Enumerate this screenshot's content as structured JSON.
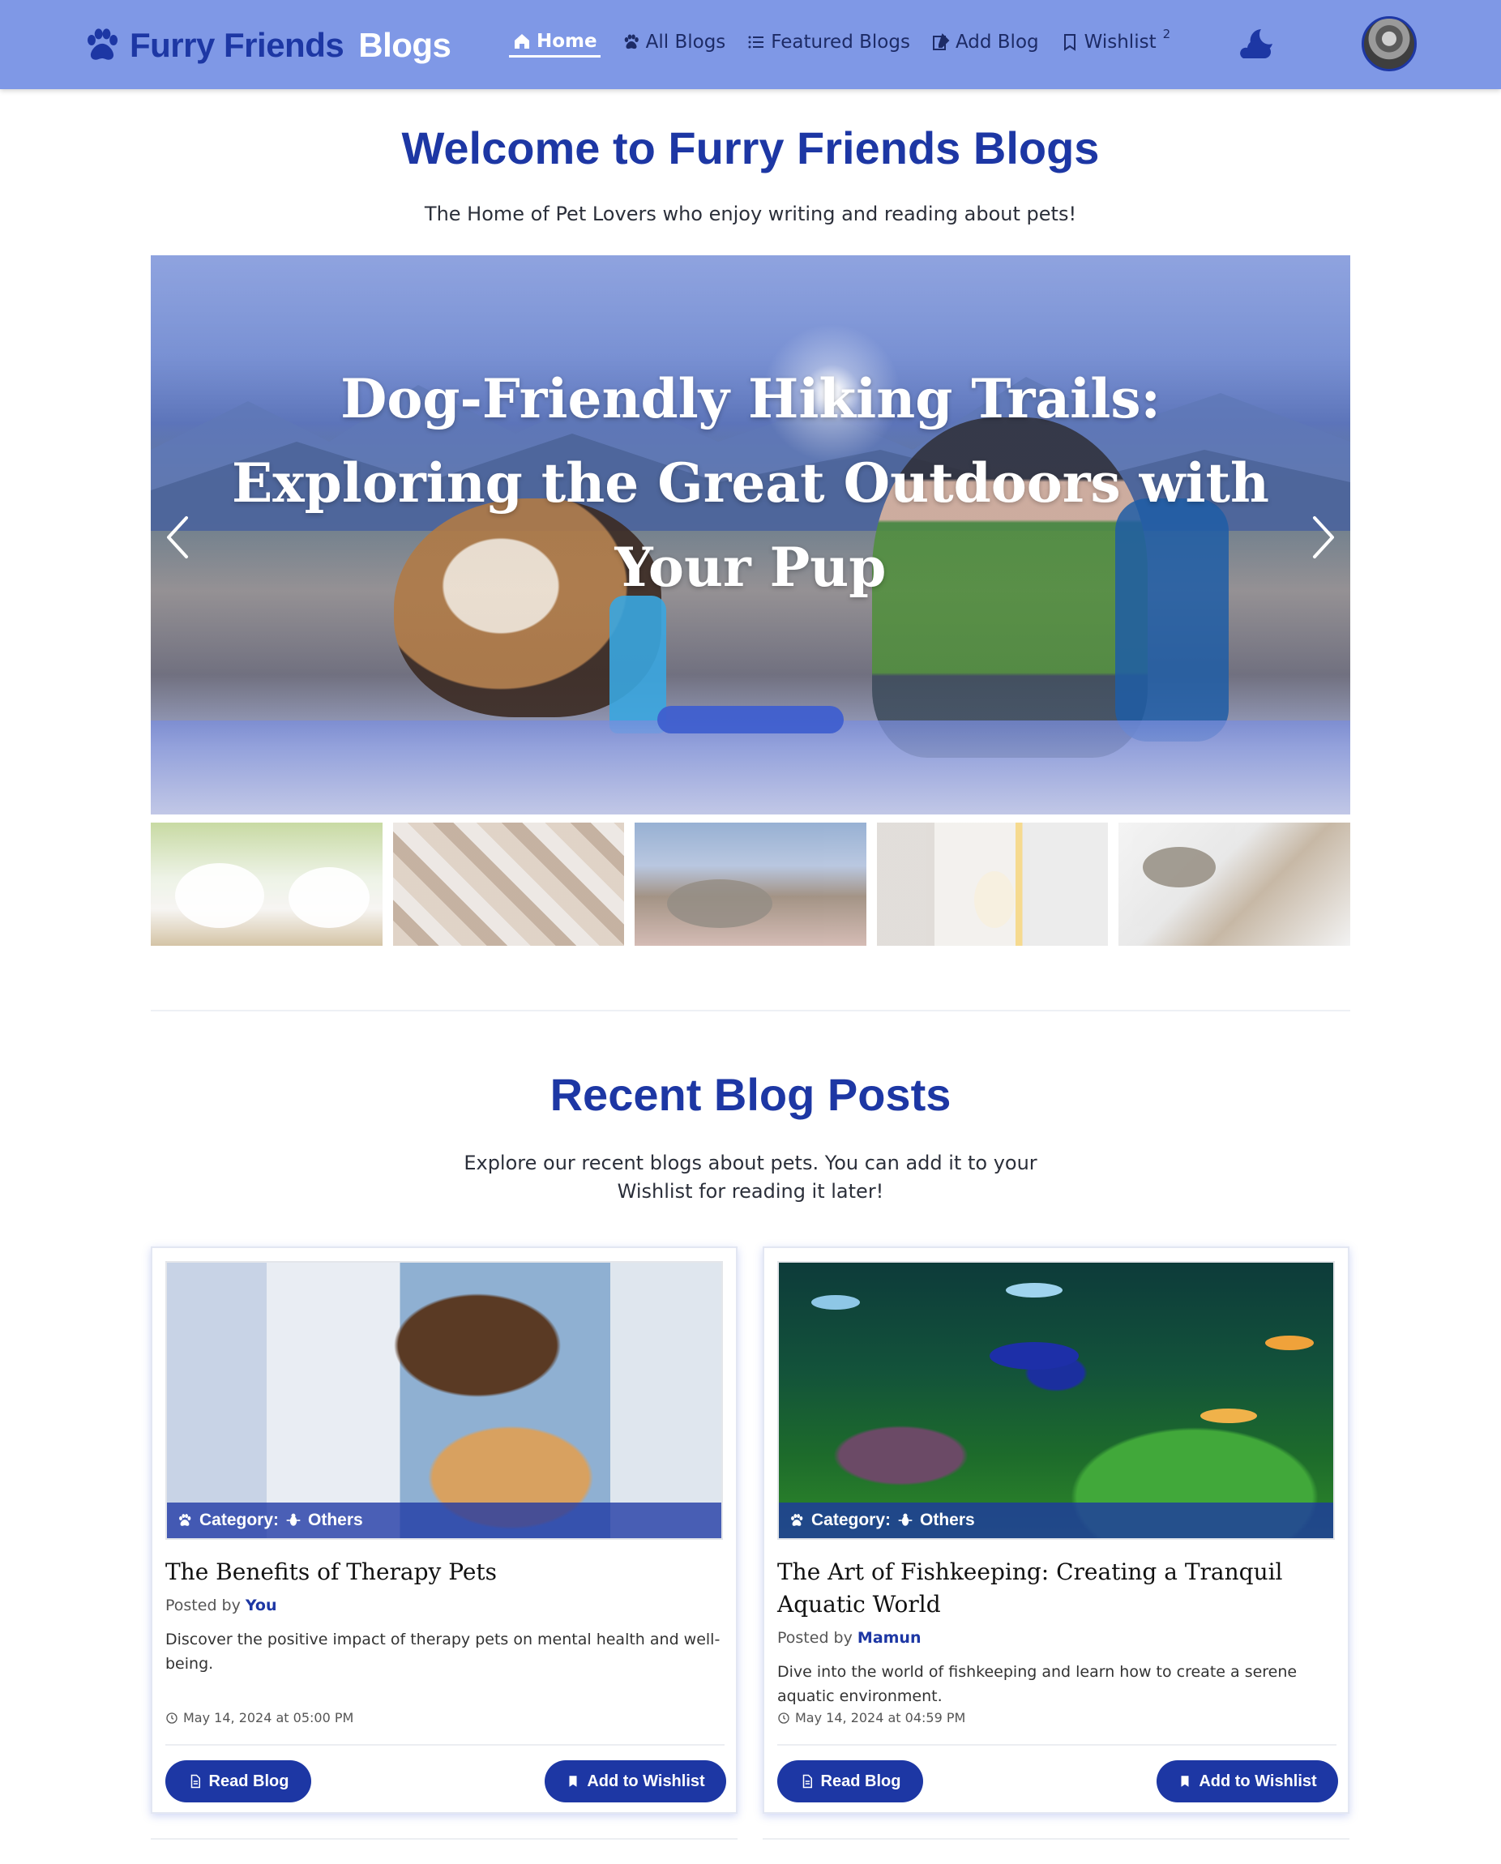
{
  "navbar": {
    "brand_part1": "Furry Friends",
    "brand_part2": "Blogs",
    "brand_icon": "paw-icon",
    "links": [
      {
        "label": "Home",
        "icon": "home-icon",
        "active": true
      },
      {
        "label": "All Blogs",
        "icon": "paw-icon"
      },
      {
        "label": "Featured Blogs",
        "icon": "list-icon"
      },
      {
        "label": "Add Blog",
        "icon": "edit-icon"
      },
      {
        "label": "Wishlist",
        "icon": "bookmark-icon",
        "badge": "2"
      }
    ],
    "theme_icon": "moon-cloud-icon",
    "colors": {
      "bar": "#7f98e6",
      "brand": "#1d37a4"
    }
  },
  "hero": {
    "title": "Welcome to Furry Friends Blogs",
    "subtitle": "The Home of Pet Lovers who enjoy writing and reading about pets!"
  },
  "slider": {
    "slide_title": "Dog-Friendly Hiking Trails: Exploring the Great Outdoors with Your Pup",
    "prev_icon": "chevron-left-icon",
    "next_icon": "chevron-right-icon",
    "thumbnails": [
      "rabbits",
      "kittens",
      "rabbit-grooming",
      "cat-indoors",
      "cat-litter-box"
    ]
  },
  "recent": {
    "title": "Recent Blog Posts",
    "subtitle": "Explore our recent blogs about pets. You can add it to your Wishlist for reading it later!"
  },
  "cards": [
    {
      "category_prefix": "Category:",
      "category": "Others",
      "title": "The Benefits of Therapy Pets",
      "posted_prefix": "Posted by",
      "author": "You",
      "description": "Discover the positive impact of therapy pets on mental health and well-being.",
      "date": "May 14, 2024 at 05:00 PM",
      "read_label": "Read Blog",
      "wishlist_label": "Add to Wishlist"
    },
    {
      "category_prefix": "Category:",
      "category": "Others",
      "title": "The Art of Fishkeeping: Creating a Tranquil Aquatic World",
      "posted_prefix": "Posted by",
      "author": "Mamun",
      "description": "Dive into the world of fishkeeping and learn how to create a serene aquatic environment.",
      "date": "May 14, 2024 at 04:59 PM",
      "read_label": "Read Blog",
      "wishlist_label": "Add to Wishlist"
    }
  ],
  "colors": {
    "accent": "#1d37a4",
    "text": "#2b2f3a"
  }
}
